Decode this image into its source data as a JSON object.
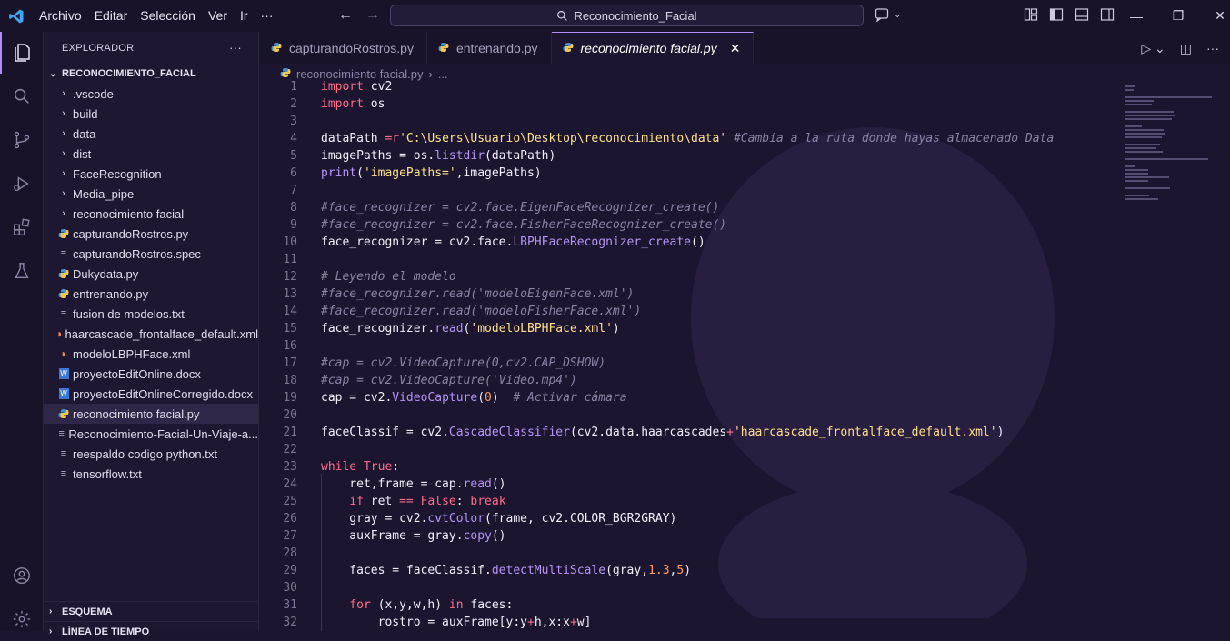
{
  "titlebar": {
    "menu": [
      "Archivo",
      "Editar",
      "Selección",
      "Ver",
      "Ir",
      "···"
    ],
    "search": "Reconocimiento_Facial"
  },
  "sidebar": {
    "header": "EXPLORADOR",
    "more": "···",
    "root": "RECONOCIMIENTO_FACIAL",
    "folders": [
      ".vscode",
      "build",
      "data",
      "dist",
      "FaceRecognition",
      "Media_pipe",
      "reconocimiento facial"
    ],
    "files": [
      {
        "name": "capturandoRostros.py",
        "icon": "python-icon"
      },
      {
        "name": "capturandoRostros.spec",
        "icon": "lines-icon"
      },
      {
        "name": "Dukydata.py",
        "icon": "python-icon"
      },
      {
        "name": "entrenando.py",
        "icon": "python-icon"
      },
      {
        "name": "fusion de modelos.txt",
        "icon": "lines-icon"
      },
      {
        "name": "haarcascade_frontalface_default.xml",
        "icon": "rss-icon"
      },
      {
        "name": "modeloLBPHFace.xml",
        "icon": "rss-icon"
      },
      {
        "name": "proyectoEditOnline.docx",
        "icon": "word-icon"
      },
      {
        "name": "proyectoEditOnlineCorregido.docx",
        "icon": "word-icon"
      },
      {
        "name": "reconocimiento facial.py",
        "icon": "python-icon"
      },
      {
        "name": "Reconocimiento-Facial-Un-Viaje-a...",
        "icon": "lines-icon"
      },
      {
        "name": "reespaldo codigo python.txt",
        "icon": "lines-icon"
      },
      {
        "name": "tensorflow.txt",
        "icon": "lines-icon"
      }
    ],
    "selected_file": "reconocimiento facial.py",
    "outline": "ESQUEMA",
    "timeline": "LÍNEA DE TIEMPO"
  },
  "tabs": [
    {
      "label": "capturandoRostros.py",
      "active": false
    },
    {
      "label": "entrenando.py",
      "active": false
    },
    {
      "label": "reconocimiento facial.py",
      "active": true
    }
  ],
  "breadcrumb": {
    "file": "reconocimiento facial.py",
    "rest": "..."
  },
  "code_lines": [
    {
      "n": "1",
      "tokens": [
        [
          "kw",
          "import"
        ],
        [
          "t",
          " cv2"
        ]
      ]
    },
    {
      "n": "2",
      "tokens": [
        [
          "kw",
          "import"
        ],
        [
          "t",
          " os"
        ]
      ]
    },
    {
      "n": "3",
      "tokens": []
    },
    {
      "n": "4",
      "tokens": [
        [
          "t",
          "dataPath "
        ],
        [
          "op",
          "="
        ],
        [
          "kw",
          "r"
        ],
        [
          "str",
          "'C:\\Users\\Usuario\\Desktop\\reconocimiento\\data'"
        ],
        [
          "t",
          " "
        ],
        [
          "cm",
          "#Cambia a la ruta donde hayas almacenado Data"
        ]
      ]
    },
    {
      "n": "5",
      "tokens": [
        [
          "t",
          "imagePaths = os."
        ],
        [
          "fn",
          "listdir"
        ],
        [
          "t",
          "(dataPath)"
        ]
      ]
    },
    {
      "n": "6",
      "tokens": [
        [
          "fn",
          "print"
        ],
        [
          "t",
          "("
        ],
        [
          "str",
          "'imagePaths='"
        ],
        [
          "t",
          ",imagePaths)"
        ]
      ]
    },
    {
      "n": "7",
      "tokens": []
    },
    {
      "n": "8",
      "tokens": [
        [
          "cm",
          "#face_recognizer = cv2.face.EigenFaceRecognizer_create()"
        ]
      ]
    },
    {
      "n": "9",
      "tokens": [
        [
          "cm",
          "#face_recognizer = cv2.face.FisherFaceRecognizer_create()"
        ]
      ]
    },
    {
      "n": "10",
      "tokens": [
        [
          "t",
          "face_recognizer = cv2.face."
        ],
        [
          "fn",
          "LBPHFaceRecognizer_create"
        ],
        [
          "t",
          "()"
        ]
      ]
    },
    {
      "n": "11",
      "tokens": []
    },
    {
      "n": "12",
      "tokens": [
        [
          "cm",
          "# Leyendo el modelo"
        ]
      ]
    },
    {
      "n": "13",
      "tokens": [
        [
          "cm",
          "#face_recognizer.read('modeloEigenFace.xml')"
        ]
      ]
    },
    {
      "n": "14",
      "tokens": [
        [
          "cm",
          "#face_recognizer.read('modeloFisherFace.xml')"
        ]
      ]
    },
    {
      "n": "15",
      "tokens": [
        [
          "t",
          "face_recognizer."
        ],
        [
          "fn",
          "read"
        ],
        [
          "t",
          "("
        ],
        [
          "str",
          "'modeloLBPHFace.xml'"
        ],
        [
          "t",
          ")"
        ]
      ]
    },
    {
      "n": "16",
      "tokens": []
    },
    {
      "n": "17",
      "tokens": [
        [
          "cm",
          "#cap = cv2.VideoCapture(0,cv2.CAP_DSHOW)"
        ]
      ]
    },
    {
      "n": "18",
      "tokens": [
        [
          "cm",
          "#cap = cv2.VideoCapture('Video.mp4')"
        ]
      ]
    },
    {
      "n": "19",
      "tokens": [
        [
          "t",
          "cap = cv2."
        ],
        [
          "fn",
          "VideoCapture"
        ],
        [
          "t",
          "("
        ],
        [
          "num",
          "0"
        ],
        [
          "t",
          ")  "
        ],
        [
          "cm",
          "# Activar cámara"
        ]
      ]
    },
    {
      "n": "20",
      "tokens": []
    },
    {
      "n": "21",
      "tokens": [
        [
          "t",
          "faceClassif = cv2."
        ],
        [
          "fn",
          "CascadeClassifier"
        ],
        [
          "t",
          "(cv2.data.haarcascades"
        ],
        [
          "op",
          "+"
        ],
        [
          "str",
          "'haarcascade_frontalface_default.xml'"
        ],
        [
          "t",
          ")"
        ]
      ]
    },
    {
      "n": "22",
      "tokens": []
    },
    {
      "n": "23",
      "tokens": [
        [
          "kw",
          "while"
        ],
        [
          "t",
          " "
        ],
        [
          "kw",
          "True"
        ],
        [
          "t",
          ":"
        ]
      ]
    },
    {
      "n": "24",
      "tokens": [
        [
          "t",
          "    ret,frame = cap."
        ],
        [
          "fn",
          "read"
        ],
        [
          "t",
          "()"
        ]
      ]
    },
    {
      "n": "25",
      "tokens": [
        [
          "t",
          "    "
        ],
        [
          "kw",
          "if"
        ],
        [
          "t",
          " ret "
        ],
        [
          "op",
          "=="
        ],
        [
          "t",
          " "
        ],
        [
          "kw",
          "False"
        ],
        [
          "t",
          ": "
        ],
        [
          "kw",
          "break"
        ]
      ]
    },
    {
      "n": "26",
      "tokens": [
        [
          "t",
          "    gray = cv2."
        ],
        [
          "fn",
          "cvtColor"
        ],
        [
          "t",
          "(frame, cv2.COLOR_BGR2GRAY)"
        ]
      ]
    },
    {
      "n": "27",
      "tokens": [
        [
          "t",
          "    auxFrame = gray."
        ],
        [
          "fn",
          "copy"
        ],
        [
          "t",
          "()"
        ]
      ]
    },
    {
      "n": "28",
      "tokens": []
    },
    {
      "n": "29",
      "tokens": [
        [
          "t",
          "    faces = faceClassif."
        ],
        [
          "fn",
          "detectMultiScale"
        ],
        [
          "t",
          "(gray,"
        ],
        [
          "num",
          "1.3"
        ],
        [
          "t",
          ","
        ],
        [
          "num",
          "5"
        ],
        [
          "t",
          ")"
        ]
      ]
    },
    {
      "n": "30",
      "tokens": []
    },
    {
      "n": "31",
      "tokens": [
        [
          "t",
          "    "
        ],
        [
          "kw",
          "for"
        ],
        [
          "t",
          " (x,y,w,h) "
        ],
        [
          "kw",
          "in"
        ],
        [
          "t",
          " faces:"
        ]
      ]
    },
    {
      "n": "32",
      "tokens": [
        [
          "t",
          "        rostro = auxFrame[y:y"
        ],
        [
          "op",
          "+"
        ],
        [
          "t",
          "h,x:x"
        ],
        [
          "op",
          "+"
        ],
        [
          "t",
          "w]"
        ]
      ]
    }
  ],
  "colors": {
    "accent": "#b28cf5",
    "background": "#1b1530",
    "keyword": "#ff6b8b",
    "string": "#ffe08a",
    "comment": "#8b83a3",
    "function": "#b794f6",
    "number": "#ff9d5c"
  }
}
